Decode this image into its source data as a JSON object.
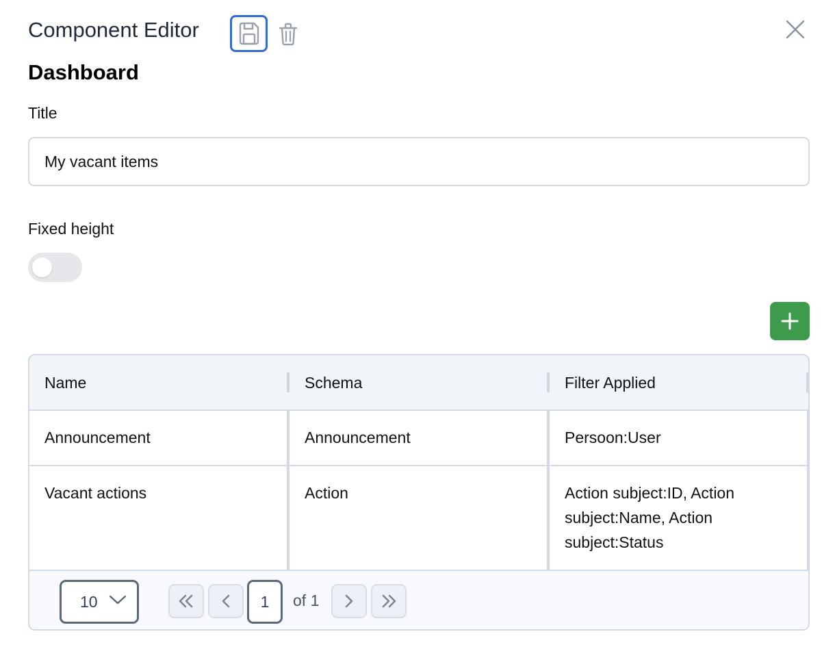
{
  "editor": {
    "title": "Component Editor",
    "section": "Dashboard"
  },
  "icons": {
    "save": "save-icon",
    "delete": "trash-icon",
    "close": "close-icon",
    "add": "plus-icon"
  },
  "form": {
    "title_label": "Title",
    "title_value": "My vacant items",
    "fixed_height_label": "Fixed height",
    "fixed_height_on": false
  },
  "table": {
    "columns": [
      "Name",
      "Schema",
      "Filter Applied"
    ],
    "rows": [
      [
        "Announcement",
        "Announcement",
        "Persoon:User"
      ],
      [
        "Vacant actions",
        "Action",
        "Action subject:ID, Action subject:Name, Action subject:Status"
      ]
    ]
  },
  "pagination": {
    "page_size": "10",
    "current_page": "1",
    "of_label": "of 1"
  },
  "colors": {
    "accent": "#2f6bd0",
    "add_button": "#3d9b4c",
    "header_bg": "#f1f4f9"
  }
}
